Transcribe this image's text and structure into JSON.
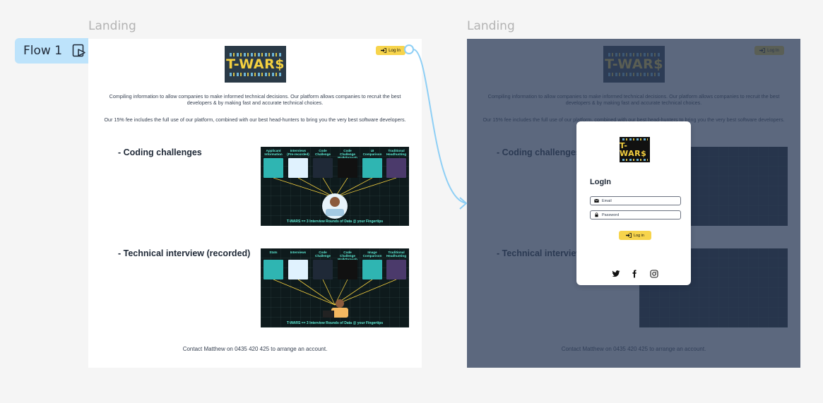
{
  "canvas": {
    "frame_labels": [
      "Landing",
      "Landing"
    ],
    "flow_label": "Flow 1"
  },
  "landing": {
    "logo_text": "T-WAR$",
    "login_label": "Log In",
    "paragraph_1": "Compiling information to allow companies to make informed technical decisions. Our platform allows companies to recruit the best developers & by making fast and accurate technical choices.",
    "paragraph_2": "Our 15% fee includes the full use of our platform, combined with our best head-hunters to bring you the very best software developers.",
    "sections": [
      {
        "title": "- Coding challenges",
        "captions": [
          "Applicant Information",
          "Interviews (Pre-recorded)",
          "Code Challenge",
          "Code Challenge Walkthrough",
          "UI Comparison",
          "Traditional Headhunting"
        ],
        "footer": "T-WARS == 3 Interview Rounds of Data @ your Fingertips"
      },
      {
        "title": "- Technical interview (recorded)",
        "captions": [
          "Stats",
          "Interviews",
          "Code Challenge",
          "Code Challenge Walkthrough",
          "Image Comparison",
          "Traditional Headhunting"
        ],
        "footer": "T-WARS == 3 Interview Rounds of Data @ your Fingertips"
      }
    ],
    "contact": "Contact Matthew on 0435 420 425 to arrange an account."
  },
  "modal": {
    "title": "LogIn",
    "email_placeholder": "Email",
    "password_placeholder": "Password",
    "login_label": "Log in",
    "social_icons": [
      "twitter-icon",
      "facebook-icon",
      "instagram-icon"
    ]
  },
  "colors": {
    "accent_yellow": "#f7d44c",
    "flow_blue": "#bde3fb",
    "overlay": "#2e3e5a",
    "teal": "#5eead4"
  }
}
